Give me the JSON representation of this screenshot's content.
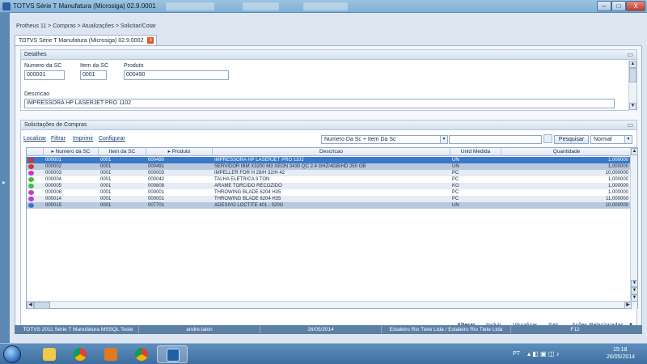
{
  "window": {
    "title": "TOTVS Série T Manufatura (Microsiga) 02.9.0001",
    "buttons": {
      "minimize": "–",
      "maximize": "□",
      "close": "X"
    }
  },
  "breadcrumb": "Protheus 11 > Compras > Atualizações > Solicitar/Cotar",
  "doc_tab": {
    "label": "TOTVS Série T Manufatura (Microsiga) 02.9.0002",
    "close": "x"
  },
  "detalhes": {
    "title": "Detalhes",
    "numero_label": "Numero da SC",
    "numero_value": "000001",
    "item_label": "Item da SC",
    "item_value": "0001",
    "produto_label": "Produto",
    "produto_value": "000490",
    "descricao_label": "Descricao",
    "descricao_value": "IMPRESSORA HP LASERJET PRO 1102"
  },
  "solicitacoes": {
    "title": "Solicitações de Compras",
    "toolbar": {
      "localizar": "Localizar",
      "filtrar": "Filtrar",
      "imprimir": "Imprimir",
      "configurar": "Configurar",
      "order_select": "Numero Da Sc + Item Da Sc",
      "search_value": "",
      "pesquisar": "Pesquisar",
      "view_select": "Normal"
    },
    "columns": [
      "Numero da SC",
      "Item da SC",
      "Produto",
      "Descricao",
      "Unid Medida",
      "Quantidade"
    ],
    "rows": [
      {
        "status_color": "#d9342b",
        "numero": "000001",
        "item": "0001",
        "produto": "000490",
        "descricao": "IMPRESSORA HP LASERJET PRO 1102",
        "unid": "UN",
        "qtd": "1,000000"
      },
      {
        "status_color": "#d9342b",
        "numero": "000002",
        "item": "0001",
        "produto": "000491",
        "descricao": "SERVIDOR IBM X3200 M3 XEON 3430 QC 2.4 GHZ/4GB/HD 250 GB",
        "unid": "UN",
        "qtd": "1,000000"
      },
      {
        "status_color": "#c13bc7",
        "numero": "000003",
        "item": "0001",
        "produto": "000003",
        "descricao": "IMPELLER FOR H 28/H 32/H 42",
        "unid": "PC",
        "qtd": "10,000000"
      },
      {
        "status_color": "#3fbf3a",
        "numero": "000004",
        "item": "0001",
        "produto": "000042",
        "descricao": "TALHA ELETRICA 3 TON",
        "unid": "PC",
        "qtd": "1,000000"
      },
      {
        "status_color": "#3fbf3a",
        "numero": "000005",
        "item": "0001",
        "produto": "000808",
        "descricao": "ARAME TORCIDO RECOZIDO",
        "unid": "KG",
        "qtd": "1,000000"
      },
      {
        "status_color": "#c13bc7",
        "numero": "000006",
        "item": "0001",
        "produto": "000001",
        "descricao": "THROWING BLADE 6204 H35",
        "unid": "PC",
        "qtd": "1,000000"
      },
      {
        "status_color": "#c13bc7",
        "numero": "000014",
        "item": "0001",
        "produto": "000001",
        "descricao": "THROWING BLADE 6204 H35",
        "unid": "PC",
        "qtd": "11,000000"
      },
      {
        "status_color": "#3b79c8",
        "numero": "000015",
        "item": "0001",
        "produto": "007701",
        "descricao": "ADESIVO LOCTITE 401 - 020G",
        "unid": "UN",
        "qtd": "10,000000"
      }
    ]
  },
  "actions": {
    "alterar": "Alterar",
    "incluir": "Incluir",
    "visualizar": "Visualizar",
    "sair": "Sair",
    "acoes": "Ações Relacionadas"
  },
  "statusbar": {
    "version": "TOTVS 2011 Série T Manufatura MSSQL Teste",
    "user": "andre.talon",
    "date": "26/05/2014",
    "company": "Estaleiro Rio Tiete Ltda / Estaleiro Rio Tiete Ltda",
    "key": "F12"
  },
  "taskbar": {
    "lang": "PT",
    "time": "15:18",
    "date": "26/05/2014"
  },
  "colors": {
    "selected_row": "#3a78c9",
    "row_alt": "#e6ecf5",
    "row_dark": "#b9c9dd"
  }
}
